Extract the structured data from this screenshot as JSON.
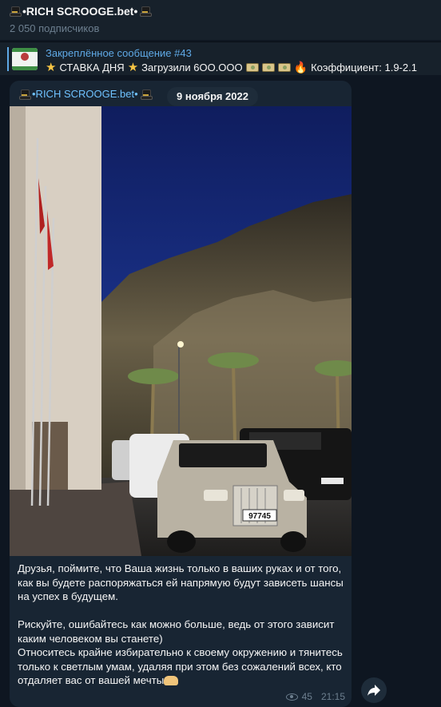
{
  "channel": {
    "title": "•RICH SCROOGE.bet•",
    "subscribers": "2 050 подписчиков"
  },
  "pinned": {
    "title": "Закреплённое сообщение #43",
    "text_part1": "СТАВКА ДНЯ",
    "text_part2": "Загрузили 6OO.OOO",
    "text_part3": "Коэффициент: 1.9-2.1"
  },
  "message": {
    "sender": "•RICH SCROOGE.bet•",
    "date": "9 ноября 2022",
    "caption_p1": "Друзья, поймите, что Ваша жизнь только в ваших руках и от того, как вы будете распоряжаться ей напрямую будут зависеть шансы на успех в будущем.",
    "caption_p2": "Рискуйте, ошибайтесь как можно больше, ведь от этого зависит каким человеком вы станете)",
    "caption_p3": "Относитесь крайне избирательно к своему окружению и тянитесь только к светлым умам, удаляя при этом без сожалений всех, кто отдаляет вас от вашей мечты",
    "views": "45",
    "time": "21:15",
    "plate": "97745"
  },
  "icons": {
    "hat": "top-hat-icon",
    "star": "star-icon",
    "money": "money-icon",
    "fire": "fire-icon",
    "eye": "eye-icon",
    "share": "share-arrow-icon"
  },
  "colors": {
    "background": "#0e1621",
    "panel": "#17212b",
    "bubble": "#182533",
    "accent": "#5fa9e6",
    "sender": "#6fc2ff",
    "muted": "#6d7f8f"
  }
}
